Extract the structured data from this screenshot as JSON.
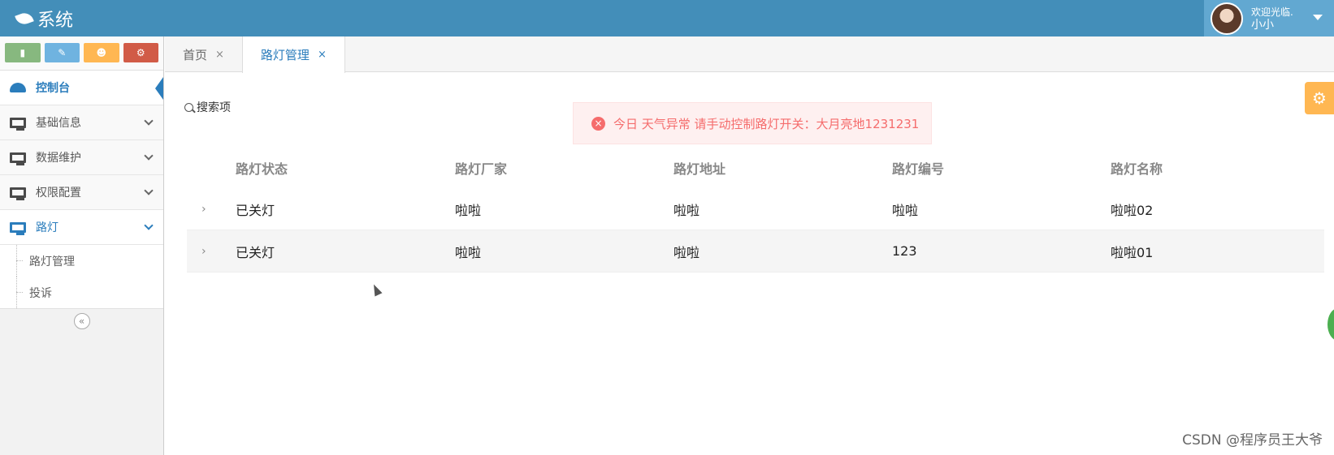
{
  "navbar": {
    "title": "系统",
    "user": {
      "welcome": "欢迎光临.",
      "name": "小小"
    }
  },
  "sidebar": {
    "shortcuts": [
      {
        "icon": "signal-icon",
        "color": "#87b87f"
      },
      {
        "icon": "pencil-icon",
        "color": "#6fb3e0"
      },
      {
        "icon": "users-icon",
        "color": "#ffb752"
      },
      {
        "icon": "cogs-icon",
        "color": "#d15b47"
      }
    ],
    "items": [
      {
        "label": "控制台"
      },
      {
        "label": "基础信息"
      },
      {
        "label": "数据维护"
      },
      {
        "label": "权限配置"
      },
      {
        "label": "路灯"
      }
    ],
    "submenu": [
      {
        "label": "路灯管理"
      },
      {
        "label": "投诉"
      }
    ],
    "collapse": "«"
  },
  "tabs": [
    {
      "label": "首页",
      "close": "×"
    },
    {
      "label": "路灯管理",
      "close": "×"
    }
  ],
  "main": {
    "search_label": "搜索项",
    "alert": {
      "icon": "×",
      "text": "今日 天气异常 请手动控制路灯开关：大月亮地1231231"
    },
    "table": {
      "headers": [
        "路灯状态",
        "路灯厂家",
        "路灯地址",
        "路灯编号",
        "路灯名称"
      ],
      "rows": [
        [
          "已关灯",
          "啦啦",
          "啦啦",
          "啦啦",
          "啦啦02"
        ],
        [
          "已关灯",
          "啦啦",
          "啦啦",
          "123",
          "啦啦01"
        ]
      ],
      "expand_glyph": "›"
    }
  },
  "watermark": "CSDN @程序员王大爷",
  "colors": {
    "navbar": "#438eb9",
    "accent": "#2b7dbc",
    "alert_text": "#f56c6c",
    "alert_bg": "#fef0f0"
  }
}
